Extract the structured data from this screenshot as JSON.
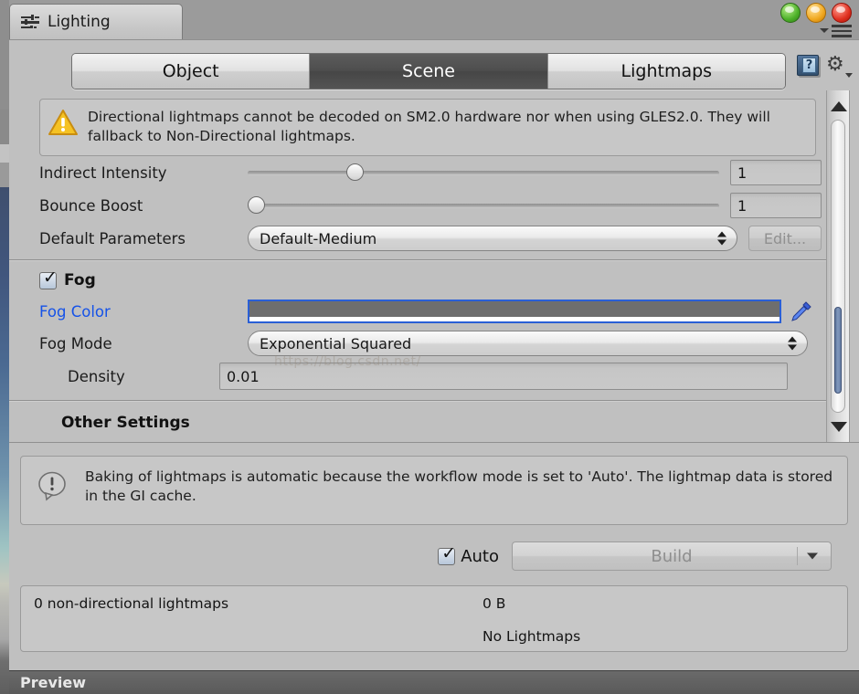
{
  "window": {
    "tab_title": "Lighting",
    "tab_icon": "sliders-icon",
    "traffic_lights": [
      "green",
      "yellow",
      "red"
    ],
    "menu_icon": "hamburger-menu-icon",
    "help_icon": "help-book-icon",
    "help_glyph": "?",
    "settings_icon": "gear-icon"
  },
  "tabs": [
    {
      "label": "Object",
      "active": false
    },
    {
      "label": "Scene",
      "active": true
    },
    {
      "label": "Lightmaps",
      "active": false
    }
  ],
  "warning": {
    "icon": "warning-triangle-icon",
    "text": "Directional lightmaps cannot be decoded on SM2.0 hardware nor when using GLES2.0. They will fallback to Non-Directional lightmaps."
  },
  "settings": {
    "indirect_intensity": {
      "label": "Indirect Intensity",
      "value": "1",
      "slider_pct": 22
    },
    "bounce_boost": {
      "label": "Bounce Boost",
      "value": "1",
      "slider_pct": 1
    },
    "default_parameters": {
      "label": "Default Parameters",
      "value": "Default-Medium",
      "edit_label": "Edit...",
      "edit_disabled": true
    }
  },
  "fog": {
    "title": "Fog",
    "enabled": true,
    "color": {
      "label": "Fog Color",
      "swatch_hex": "#6e6e6e",
      "eyedropper_icon": "eyedropper-icon"
    },
    "mode": {
      "label": "Fog Mode",
      "value": "Exponential Squared"
    },
    "density": {
      "label": "Density",
      "value": "0.01"
    }
  },
  "other_settings": {
    "title": "Other Settings"
  },
  "info": {
    "icon": "info-bubble-icon",
    "text": "Baking of lightmaps is automatic because the workflow mode is set to 'Auto'. The lightmap data is stored in the GI cache."
  },
  "build": {
    "auto_label": "Auto",
    "auto_checked": true,
    "build_label": "Build",
    "build_disabled": true,
    "dropdown_icon": "chevron-down-icon"
  },
  "stats": {
    "lightmaps_line": "0 non-directional lightmaps",
    "size": "0 B",
    "status": "No Lightmaps"
  },
  "preview": {
    "label": "Preview"
  },
  "watermark": {
    "text": "https://blog.csdn.net/"
  },
  "colors": {
    "panel": "#c0c0c0",
    "selected_tab": "#4e4e4e",
    "accent_blue": "#1552e8",
    "scroll_thumb": "#7189ae"
  }
}
